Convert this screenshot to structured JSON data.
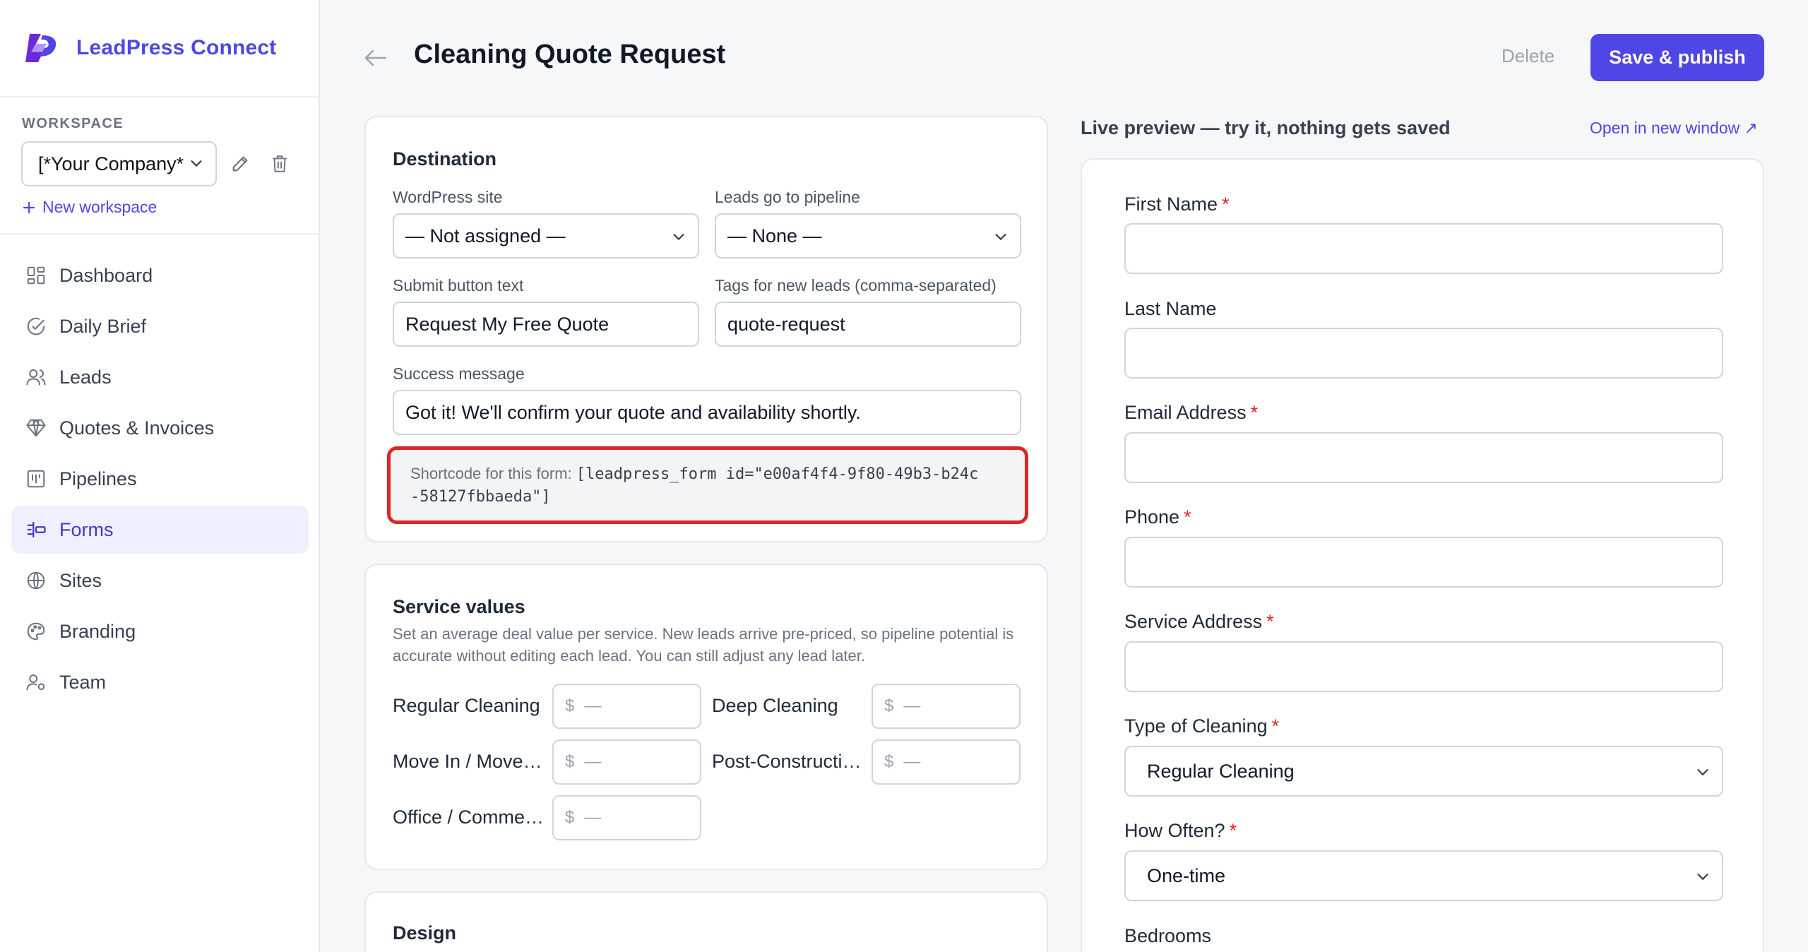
{
  "brand": {
    "name": "LeadPress Connect"
  },
  "workspace": {
    "label": "WORKSPACE",
    "selected": "[*Your Company*",
    "new_label": "New workspace"
  },
  "nav": [
    {
      "label": "Dashboard",
      "icon": "dashboard-icon"
    },
    {
      "label": "Daily Brief",
      "icon": "check-circle-icon"
    },
    {
      "label": "Leads",
      "icon": "users-icon"
    },
    {
      "label": "Quotes & Invoices",
      "icon": "diamond-icon"
    },
    {
      "label": "Pipelines",
      "icon": "pipeline-icon"
    },
    {
      "label": "Forms",
      "icon": "form-icon",
      "active": true
    },
    {
      "label": "Sites",
      "icon": "globe-icon"
    },
    {
      "label": "Branding",
      "icon": "palette-icon"
    },
    {
      "label": "Team",
      "icon": "team-icon"
    }
  ],
  "header": {
    "title": "Cleaning Quote Request",
    "delete_label": "Delete",
    "save_label": "Save & publish"
  },
  "destination": {
    "title": "Destination",
    "site_label": "WordPress site",
    "site_value": "— Not assigned —",
    "pipeline_label": "Leads go to pipeline",
    "pipeline_value": "— None —",
    "submit_label": "Submit button text",
    "submit_value": "Request My Free Quote",
    "tags_label": "Tags for new leads (comma-separated)",
    "tags_value": "quote-request",
    "success_label": "Success message",
    "success_value": "Got it! We'll confirm your quote and availability shortly.",
    "shortcode_prefix": "Shortcode for this form:",
    "shortcode_line1": "[leadpress_form id=\"e00af4f4-9f80-49b3-b24c",
    "shortcode_line2": "-58127fbbaeda\"]"
  },
  "services": {
    "title": "Service values",
    "description": "Set an average deal value per service. New leads arrive pre-priced, so pipeline potential is accurate without editing each lead. You can still adjust any lead later.",
    "currency": "$",
    "empty": "—",
    "items": [
      "Regular Cleaning",
      "Deep Cleaning",
      "Move In / Move …",
      "Post-Constructi…",
      "Office / Comme…"
    ]
  },
  "design": {
    "title": "Design"
  },
  "preview": {
    "title": "Live preview — try it, nothing gets saved",
    "open_label": "Open in new window ↗",
    "required_mark": "*",
    "fields": [
      {
        "label": "First Name",
        "required": true,
        "type": "text",
        "value": ""
      },
      {
        "label": "Last Name",
        "required": false,
        "type": "text",
        "value": ""
      },
      {
        "label": "Email Address",
        "required": true,
        "type": "text",
        "value": ""
      },
      {
        "label": "Phone",
        "required": true,
        "type": "text",
        "value": ""
      },
      {
        "label": "Service Address",
        "required": true,
        "type": "text",
        "value": ""
      },
      {
        "label": "Type of Cleaning",
        "required": true,
        "type": "select",
        "value": "Regular Cleaning"
      },
      {
        "label": "How Often?",
        "required": true,
        "type": "select",
        "value": "One-time"
      },
      {
        "label": "Bedrooms",
        "required": false,
        "type": "select",
        "value": ""
      }
    ]
  },
  "colors": {
    "accent": "#4f46e5",
    "required": "#dc2626",
    "highlight_border": "#dc2626"
  }
}
